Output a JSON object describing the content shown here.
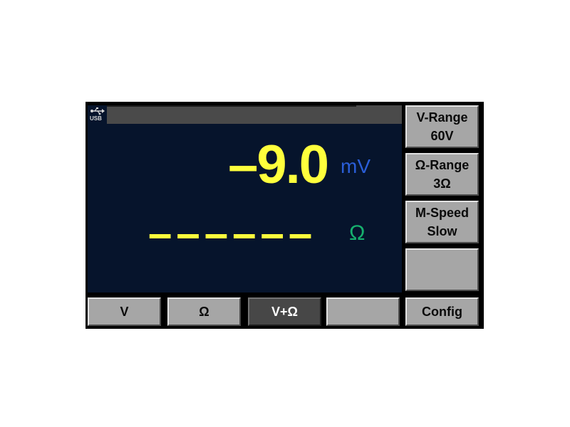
{
  "status": {
    "icon": "usb-icon",
    "usb_label": "USB"
  },
  "measurement": {
    "primary_value": "–9.0",
    "primary_unit": "mV",
    "secondary_value": "––––––",
    "secondary_unit": "Ω"
  },
  "side_menu": [
    {
      "line1": "V-Range",
      "line2": "60V"
    },
    {
      "line1": "Ω-Range",
      "line2": "3Ω"
    },
    {
      "line1": "M-Speed",
      "line2": "Slow"
    },
    {
      "line1": "",
      "line2": ""
    }
  ],
  "bottom_menu": [
    {
      "label": "V",
      "selected": false
    },
    {
      "label": "Ω",
      "selected": false
    },
    {
      "label": "V+Ω",
      "selected": true
    },
    {
      "label": "",
      "selected": false
    },
    {
      "label": "Config",
      "selected": false
    }
  ],
  "colors": {
    "screen_background": "#06142c",
    "primary_value": "#ffff3c",
    "primary_unit": "#2a5ed8",
    "secondary_unit": "#16b06e",
    "softkey": "#a6a6a6",
    "softkey_selected": "#474747"
  }
}
